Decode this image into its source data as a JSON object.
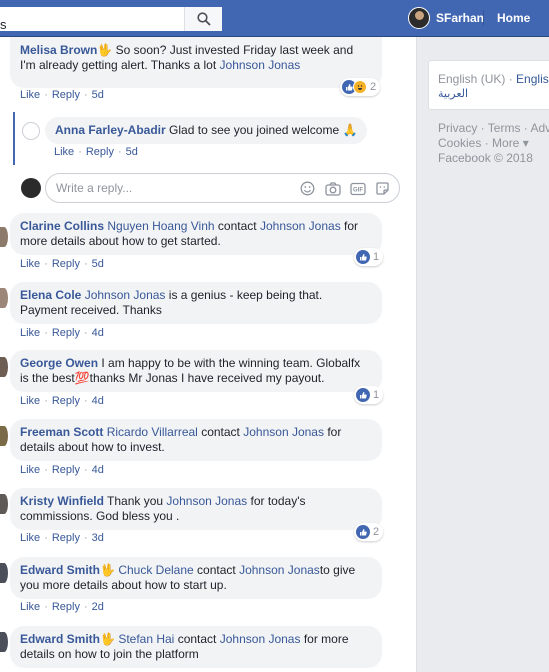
{
  "topbar": {
    "left_edge_text": "s",
    "search_placeholder": "",
    "user_name": "SFarhan",
    "home_label": "Home"
  },
  "sidebar": {
    "lang_current": "English (UK)",
    "lang_separator": "·",
    "lang_other": "English",
    "lang_arabic": "العربية",
    "footer_line1": "Privacy · Terms · Adv",
    "footer_line2": "Cookies · More ▾",
    "copyright": "Facebook © 2018"
  },
  "actions": {
    "like": "Like",
    "reply": "Reply",
    "dot": "·"
  },
  "reply_box": {
    "placeholder": "Write a reply..."
  },
  "comments": [
    {
      "author": "Melisa Brown",
      "emoji": "🖖",
      "pre": "",
      "mention": "",
      "text": "So soon? Just invested Friday last week and I'm already getting alert. Thanks a lot",
      "mention2": "Johnson Jonas",
      "text2": "",
      "time": "5d",
      "reactions": "2"
    },
    {
      "author": "Anna Farley-Abadir",
      "text": "Glad to see you joined welcome 🙏",
      "time": "5d"
    },
    {
      "author": "Clarine Collins",
      "mention": "Nguyen Hoang Vinh",
      "text": "contact",
      "mention2": "Johnson Jonas",
      "text2": "for more details about how to get started.",
      "time": "5d",
      "reactions": "1"
    },
    {
      "author": "Elena Cole",
      "mention": "Johnson Jonas",
      "text": "is a genius - keep being that. Payment received. Thanks",
      "time": "4d"
    },
    {
      "author": "George Owen",
      "text": "I am happy to be with the winning team. Globalfx is the best💯thanks Mr Jonas I have received my payout.",
      "time": "4d",
      "reactions": "1"
    },
    {
      "author": "Freeman Scott",
      "mention": "Ricardo Villarreal",
      "text": "contact",
      "mention2": "Johnson Jonas",
      "text2": "for details about how to invest.",
      "time": "4d"
    },
    {
      "author": "Kristy Winfield",
      "text": "Thank you",
      "mention": "Johnson Jonas",
      "text2": "for today's commissions. God bless you .",
      "time": "3d",
      "reactions": "2"
    },
    {
      "author": "Edward Smith",
      "emoji": "🖖",
      "mention": "Chuck Delane",
      "text": "contact",
      "mention2": "Johnson Jonas",
      "text2": "to give you more details about how to start up.",
      "time": "2d"
    },
    {
      "author": "Edward Smith",
      "emoji": "🖖",
      "mention": "Stefan Hai",
      "text": "contact",
      "mention2": "Johnson Jonas",
      "text2": "for more details on how to join the platform"
    }
  ]
}
